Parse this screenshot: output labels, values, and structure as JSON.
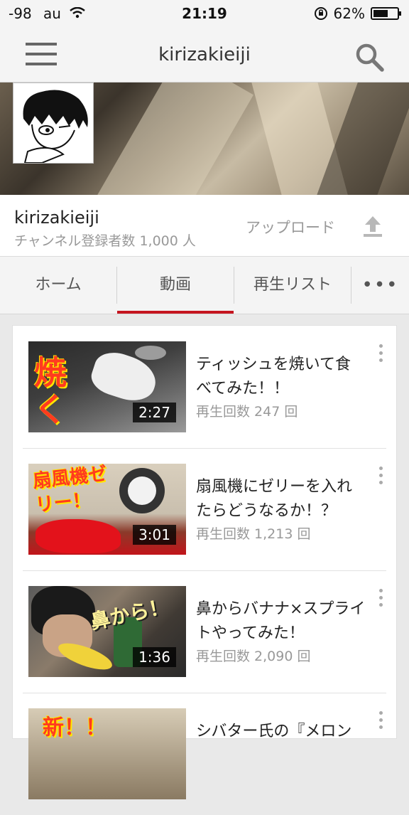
{
  "status": {
    "signal": "-98",
    "carrier": "au",
    "time": "21:19",
    "battery": "62%",
    "battery_level": 0.62
  },
  "appbar": {
    "title": "kirizakieiji"
  },
  "channel": {
    "name": "kirizakieiji",
    "subscribers": "チャンネル登録者数 1,000 人",
    "upload_label": "アップロード"
  },
  "tabs": [
    {
      "label": "ホーム"
    },
    {
      "label": "動画"
    },
    {
      "label": "再生リスト"
    },
    {
      "label": "•••"
    }
  ],
  "videos": [
    {
      "title": "ティッシュを焼いて食べてみた！！",
      "views": "再生回数 247 回",
      "duration": "2:27",
      "overlay": "焼く"
    },
    {
      "title": "扇風機にゼリーを入れたらどうなるか！？",
      "views": "再生回数 1,213 回",
      "duration": "3:01",
      "overlay": "扇風機ゼリー！"
    },
    {
      "title": "鼻からバナナ×スプライトやってみた！",
      "views": "再生回数 2,090 回",
      "duration": "1:36",
      "overlay": "鼻から！"
    },
    {
      "title": "シバター氏の『メロン",
      "views": "",
      "duration": "",
      "overlay": "新！！"
    }
  ],
  "colors": {
    "accent": "#c5151f",
    "bar_bg": "#f4f4f4"
  }
}
